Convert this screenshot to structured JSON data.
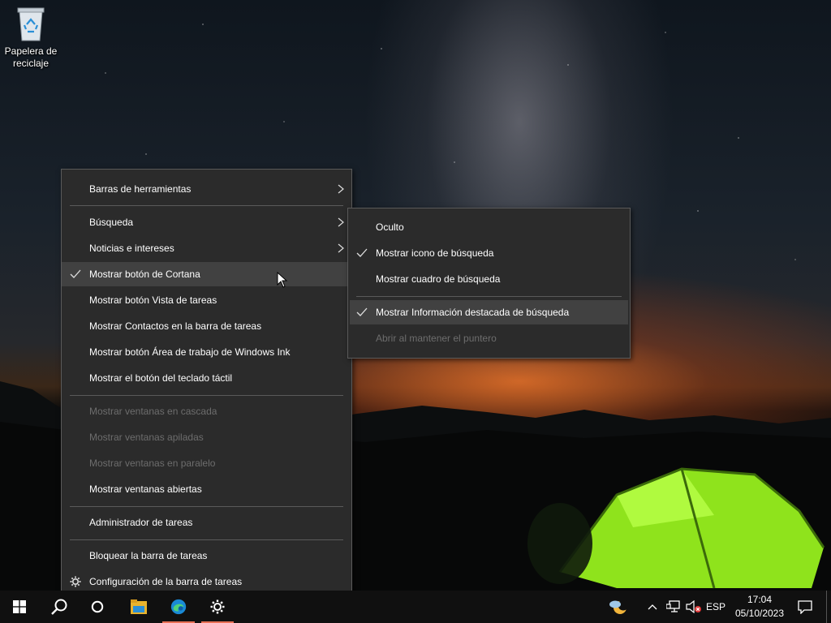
{
  "desktop": {
    "recycle_bin_label": "Papelera de reciclaje"
  },
  "context_menu": {
    "items": [
      {
        "label": "Barras de herramientas",
        "submenu": true,
        "checked": false,
        "disabled": false
      },
      {
        "label": "Búsqueda",
        "submenu": true,
        "checked": false,
        "disabled": false
      },
      {
        "label": "Noticias e intereses",
        "submenu": true,
        "checked": false,
        "disabled": false
      },
      {
        "label": "Mostrar botón de Cortana",
        "submenu": false,
        "checked": true,
        "disabled": false
      },
      {
        "label": "Mostrar botón Vista de tareas",
        "submenu": false,
        "checked": false,
        "disabled": false
      },
      {
        "label": "Mostrar Contactos en la barra de tareas",
        "submenu": false,
        "checked": false,
        "disabled": false
      },
      {
        "label": "Mostrar botón Área de trabajo de Windows Ink",
        "submenu": false,
        "checked": false,
        "disabled": false
      },
      {
        "label": "Mostrar el botón del teclado táctil",
        "submenu": false,
        "checked": false,
        "disabled": false
      },
      {
        "label": "Mostrar ventanas en cascada",
        "submenu": false,
        "checked": false,
        "disabled": true
      },
      {
        "label": "Mostrar ventanas apiladas",
        "submenu": false,
        "checked": false,
        "disabled": true
      },
      {
        "label": "Mostrar ventanas en paralelo",
        "submenu": false,
        "checked": false,
        "disabled": true
      },
      {
        "label": "Mostrar ventanas abiertas",
        "submenu": false,
        "checked": false,
        "disabled": false
      },
      {
        "label": "Administrador de tareas",
        "submenu": false,
        "checked": false,
        "disabled": false
      },
      {
        "label": "Bloquear la barra de tareas",
        "submenu": false,
        "checked": false,
        "disabled": false
      },
      {
        "label": "Configuración de la barra de tareas",
        "icon": "gear-icon",
        "submenu": false,
        "checked": false,
        "disabled": false
      }
    ]
  },
  "search_submenu": {
    "items": [
      {
        "label": "Oculto",
        "checked": false,
        "disabled": false
      },
      {
        "label": "Mostrar icono de búsqueda",
        "checked": true,
        "disabled": false
      },
      {
        "label": "Mostrar cuadro de búsqueda",
        "checked": false,
        "disabled": false
      },
      {
        "label": "Mostrar Información destacada de búsqueda",
        "checked": true,
        "disabled": false
      },
      {
        "label": "Abrir al mantener el puntero",
        "checked": false,
        "disabled": true
      }
    ]
  },
  "taskbar": {
    "apps": [
      "start-icon",
      "search-icon",
      "cortana-icon",
      "file-explorer-icon",
      "edge-icon",
      "settings-icon"
    ],
    "tray": {
      "language": "ESP",
      "time": "17:04",
      "date": "05/10/2023"
    },
    "accent": "#e86f55"
  },
  "colors": {
    "menu_background": "#2b2b2b",
    "menu_hover": "#414141",
    "menu_disabled_text": "#6d6d6d",
    "taskbar_background": "#101010"
  }
}
